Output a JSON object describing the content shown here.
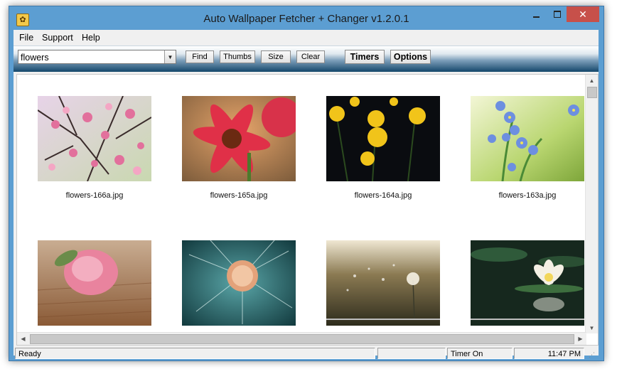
{
  "window": {
    "title": "Auto Wallpaper Fetcher + Changer v1.2.0.1",
    "close_glyph": "✕"
  },
  "menu": {
    "file": "File",
    "support": "Support",
    "help": "Help"
  },
  "toolbar": {
    "search_value": "flowers",
    "find": "Find",
    "thumbs": "Thumbs",
    "size": "Size",
    "clear": "Clear",
    "timers": "Timers",
    "options": "Options"
  },
  "thumbnails": [
    {
      "caption": "flowers-166a.jpg",
      "scene": "pink-blossom"
    },
    {
      "caption": "flowers-165a.jpg",
      "scene": "red-gerbera"
    },
    {
      "caption": "flowers-164a.jpg",
      "scene": "yellow-roses-dark"
    },
    {
      "caption": "flowers-163a.jpg",
      "scene": "blue-forget-me-not"
    },
    {
      "caption": "",
      "scene": "pink-rose-wood"
    },
    {
      "caption": "",
      "scene": "dandelion-teal"
    },
    {
      "caption": "",
      "scene": "dandelion-sunset"
    },
    {
      "caption": "",
      "scene": "water-lily"
    }
  ],
  "status": {
    "text": "Ready",
    "timer": "Timer On",
    "clock": "11:47 PM"
  },
  "colors": {
    "frame": "#5c9ed2",
    "close": "#c7504a",
    "toolbar_dark": "#14476b"
  }
}
